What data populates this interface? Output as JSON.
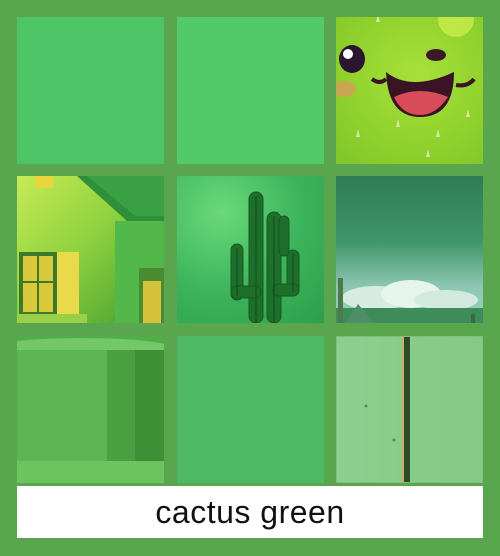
{
  "caption": "cactus green",
  "colors": {
    "background": "#5aa64f",
    "swatch_green": "#4dc466",
    "caption_bg": "#ffffff"
  },
  "tiles": [
    {
      "name": "plain-green-swatch-1"
    },
    {
      "name": "plain-green-swatch-2"
    },
    {
      "name": "cactus-face-illustration"
    },
    {
      "name": "green-house-painting"
    },
    {
      "name": "cactus-photo"
    },
    {
      "name": "desert-sky-landscape"
    },
    {
      "name": "green-ceramic-bowl"
    },
    {
      "name": "plain-green-swatch-3"
    },
    {
      "name": "green-painted-wall"
    }
  ]
}
